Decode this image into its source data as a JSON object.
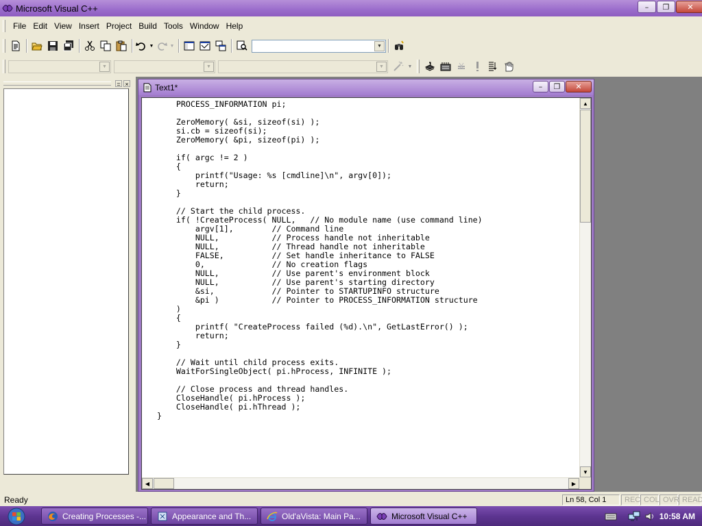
{
  "window": {
    "title": "Microsoft Visual C++",
    "minimize_glyph": "–",
    "restore_glyph": "❐",
    "close_glyph": "✕"
  },
  "menu": {
    "items": [
      {
        "label": "File"
      },
      {
        "label": "Edit"
      },
      {
        "label": "View"
      },
      {
        "label": "Insert"
      },
      {
        "label": "Project"
      },
      {
        "label": "Build"
      },
      {
        "label": "Tools"
      },
      {
        "label": "Window"
      },
      {
        "label": "Help"
      }
    ]
  },
  "toolbar": {
    "find_combo_value": "",
    "class_combo_value": "",
    "members_combo_value": "",
    "functions_combo_value": "",
    "dropdown_arrow": "▼"
  },
  "left_pane": {
    "restore_glyph": "=",
    "close_glyph": "×"
  },
  "document": {
    "title": "Text1*",
    "code_lines": [
      "    PROCESS_INFORMATION pi;",
      "",
      "    ZeroMemory( &si, sizeof(si) );",
      "    si.cb = sizeof(si);",
      "    ZeroMemory( &pi, sizeof(pi) );",
      "",
      "    if( argc != 2 )",
      "    {",
      "        printf(\"Usage: %s [cmdline]\\n\", argv[0]);",
      "        return;",
      "    }",
      "",
      "    // Start the child process.",
      "    if( !CreateProcess( NULL,   // No module name (use command line)",
      "        argv[1],        // Command line",
      "        NULL,           // Process handle not inheritable",
      "        NULL,           // Thread handle not inheritable",
      "        FALSE,          // Set handle inheritance to FALSE",
      "        0,              // No creation flags",
      "        NULL,           // Use parent's environment block",
      "        NULL,           // Use parent's starting directory",
      "        &si,            // Pointer to STARTUPINFO structure",
      "        &pi )           // Pointer to PROCESS_INFORMATION structure",
      "    )",
      "    {",
      "        printf( \"CreateProcess failed (%d).\\n\", GetLastError() );",
      "        return;",
      "    }",
      "",
      "    // Wait until child process exits.",
      "    WaitForSingleObject( pi.hProcess, INFINITE );",
      "",
      "    // Close process and thread handles.",
      "    CloseHandle( pi.hProcess );",
      "    CloseHandle( pi.hThread );",
      "}"
    ],
    "scroll_up": "▲",
    "scroll_down": "▼",
    "scroll_left": "◀",
    "scroll_right": "▶"
  },
  "status_bar": {
    "text": "Ready",
    "position": "Ln 58, Col 1",
    "rec": "REC",
    "col": "COL",
    "ovr": "OVR",
    "read": "READ"
  },
  "taskbar": {
    "buttons": [
      {
        "label": "Creating Processes -...",
        "icon": "firefox-icon",
        "active": false
      },
      {
        "label": "Appearance and Th...",
        "icon": "control-panel-icon",
        "active": false
      },
      {
        "label": "Old'aVista: Main Pa...",
        "icon": "internet-explorer-icon",
        "active": false
      },
      {
        "label": "Microsoft Visual C++",
        "icon": "visual-cpp-icon",
        "active": true
      }
    ],
    "clock": "10:58 AM"
  },
  "colors": {
    "titlebar": "#9a6ccb",
    "taskbar": "#5d3591",
    "mdi_background": "#808080",
    "chrome": "#ece9d8"
  }
}
